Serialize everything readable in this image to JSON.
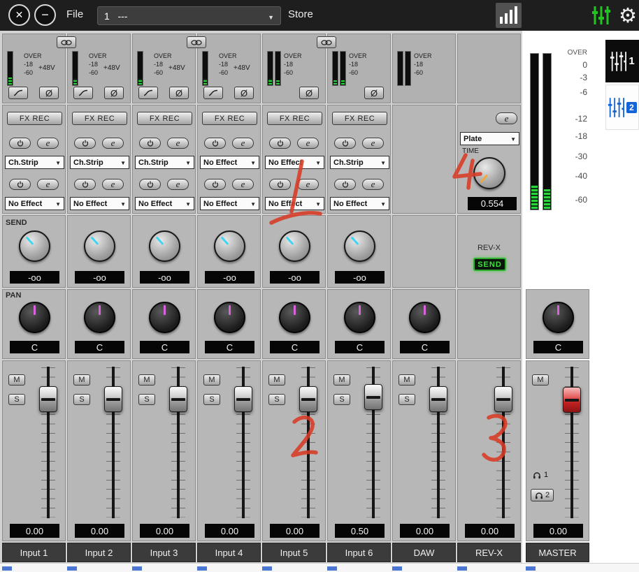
{
  "topbar": {
    "file_label": "File",
    "scene_value": "1   ---",
    "store_label": "Store"
  },
  "side_tabs": {
    "tab1": "1",
    "tab2": "2"
  },
  "section_labels": {
    "send": "SEND",
    "pan": "PAN"
  },
  "meter_scale": [
    "OVER",
    "0",
    "-3",
    "-6",
    "-12",
    "-18",
    "-30",
    "-40",
    "-60"
  ],
  "common": {
    "fx_rec": "FX REC",
    "meter_over": "OVER",
    "meter_mid": "-18",
    "meter_low": "-60",
    "phantom": "+48V",
    "phase": "Ø",
    "fx_edit": "e",
    "mute": "M",
    "solo": "S"
  },
  "revx": {
    "type_value": "Plate",
    "time_label": "TIME",
    "time_value": "0.554",
    "send_title": "REV-X",
    "send_button": "SEND"
  },
  "master": {
    "phones1": "1",
    "phones2": "2"
  },
  "channels": [
    {
      "name": "Input 1",
      "fx1": "Ch.Strip",
      "fx2": "No Effect",
      "send": "-oo",
      "pan": "C",
      "fader": "0.00"
    },
    {
      "name": "Input 2",
      "fx1": "Ch.Strip",
      "fx2": "No Effect",
      "send": "-oo",
      "pan": "C",
      "fader": "0.00"
    },
    {
      "name": "Input 3",
      "fx1": "Ch.Strip",
      "fx2": "No Effect",
      "send": "-oo",
      "pan": "C",
      "fader": "0.00"
    },
    {
      "name": "Input 4",
      "fx1": "No Effect",
      "fx2": "No Effect",
      "send": "-oo",
      "pan": "C",
      "fader": "0.00"
    },
    {
      "name": "Input 5",
      "fx1": "No Effect",
      "fx2": "No Effect",
      "send": "-oo",
      "pan": "C",
      "fader": "0.00"
    },
    {
      "name": "Input 6",
      "fx1": "Ch.Strip",
      "fx2": "No Effect",
      "send": "-oo",
      "pan": "C",
      "fader": "0.50"
    },
    {
      "name": "DAW",
      "pan": "C",
      "fader": "0.00"
    },
    {
      "name": "REV-X",
      "fader": "0.00"
    },
    {
      "name": "MASTER",
      "pan": "C",
      "fader": "0.00"
    }
  ],
  "annotations": [
    "1",
    "2",
    "3",
    "4"
  ]
}
